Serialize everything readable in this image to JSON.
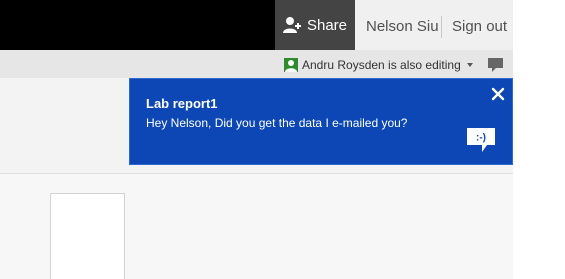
{
  "header": {
    "share_label": "Share",
    "user_name": "Nelson Siu",
    "sign_out_label": "Sign out"
  },
  "status": {
    "editing_text": "Andru Roysden is also editing"
  },
  "notification": {
    "title": "Lab report1",
    "message": "Hey Nelson, Did you get the data I e-mailed you?",
    "reply_emoticon": ":-)",
    "close_glyph": "×"
  },
  "colors": {
    "topbar": "#000000",
    "share_bg": "#444444",
    "notification_bg": "#0d47b6",
    "presence_green": "#2e8b2e"
  },
  "icons": {
    "share": "add-person-icon",
    "presence": "user-presence-icon",
    "dropdown": "caret-down-icon",
    "chat": "chat-bubble-icon",
    "close": "close-icon",
    "reply": "chat-reply-icon"
  }
}
